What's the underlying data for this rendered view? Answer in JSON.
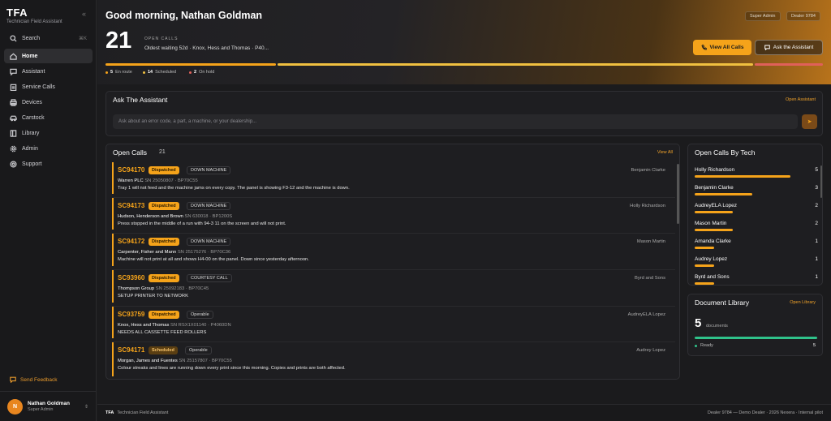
{
  "app": {
    "short": "TFA",
    "name": "Technician Field Assistant"
  },
  "nav": {
    "search": "Search",
    "search_kbd": "⌘K",
    "items": [
      {
        "label": "Home",
        "icon": "home-icon"
      },
      {
        "label": "Assistant",
        "icon": "chat-icon"
      },
      {
        "label": "Service Calls",
        "icon": "clipboard-icon"
      },
      {
        "label": "Devices",
        "icon": "printer-icon"
      },
      {
        "label": "Carstock",
        "icon": "car-icon"
      },
      {
        "label": "Library",
        "icon": "book-icon"
      },
      {
        "label": "Admin",
        "icon": "gear-icon"
      },
      {
        "label": "Support",
        "icon": "lifebuoy-icon"
      }
    ],
    "feedback": "Send Feedback"
  },
  "user": {
    "initial": "N",
    "name": "Nathan Goldman",
    "role": "Super Admin"
  },
  "hero": {
    "greeting": "Good morning, Nathan Goldman",
    "role_pill": "Super Admin",
    "dealer_pill": "Dealer 9784",
    "open_calls": "21",
    "open_calls_label": "OPEN CALLS",
    "oldest": "Oldest waiting 52d · Knox, Hess and Thomas · P40...",
    "view_all": "View All Calls",
    "ask": "Ask the Assistant",
    "stats": [
      {
        "count": "5",
        "label": "En route",
        "color": "#f5a31a"
      },
      {
        "count": "14",
        "label": "Scheduled",
        "color": "#f0c040"
      },
      {
        "count": "2",
        "label": "On hold",
        "color": "#e0605a"
      }
    ]
  },
  "ask_panel": {
    "title": "Ask The Assistant",
    "link": "Open Assistant",
    "placeholder": "Ask about an error code, a part, a machine, or your dealership..."
  },
  "open_calls": {
    "title": "Open Calls",
    "count": "21",
    "link": "View All",
    "rows": [
      {
        "id": "SC94170",
        "status": "Dispatched",
        "type": "DOWN MACHINE",
        "customer": "Warren PLC",
        "sn": "SN 25050807 · BP70C55",
        "desc": "Tray 1 will not feed and the machine jams on every copy. The panel is showing F3-12 and the machine is down.",
        "tech": "Benjamin Clarke"
      },
      {
        "id": "SC94173",
        "status": "Dispatched",
        "type": "DOWN MACHINE",
        "customer": "Hudson, Henderson and Brown",
        "sn": "SN 630018 · BP1200S",
        "desc": "Press stopped in the middle of a run with 94-3 11 on the screen and will not print.",
        "tech": "Holly Richardson"
      },
      {
        "id": "SC94172",
        "status": "Dispatched",
        "type": "DOWN MACHINE",
        "customer": "Carpenter, Fisher and Mann",
        "sn": "SN 25175276 · BP70C36",
        "desc": "Machine will not print at all and shows H4-00 on the panel. Down since yesterday afternoon.",
        "tech": "Mason Martin"
      },
      {
        "id": "SC93960",
        "status": "Dispatched",
        "type": "COURTESY CALL",
        "customer": "Thompson Group",
        "sn": "SN 25092183 · BP70C45",
        "desc": "SETUP PRINTER TO NETWORK",
        "tech": "Byrd and Sons"
      },
      {
        "id": "SC93759",
        "status": "Dispatched",
        "type": "Operable",
        "customer": "Knox, Hess and Thomas",
        "sn": "SN RSX1X01140 · P4060DN",
        "desc": "NEEDS ALL CASSETTE FEED ROLLERS",
        "tech": "AudreyELA Lopez"
      },
      {
        "id": "SC94171",
        "status": "Scheduled",
        "type": "Operable",
        "customer": "Morgan, James and Fuentes",
        "sn": "SN 25157807 · BP70C55",
        "desc": "Colour streaks and lines are running down every print since this morning. Copies and prints are both affected.",
        "tech": "Audrey Lopez"
      }
    ]
  },
  "techs": {
    "title": "Open Calls By Tech",
    "rows": [
      {
        "name": "Holly Richardson",
        "count": 5,
        "fill": 1.0
      },
      {
        "name": "Benjamin Clarke",
        "count": 3,
        "fill": 0.6
      },
      {
        "name": "AudreyELA Lopez",
        "count": 2,
        "fill": 0.4
      },
      {
        "name": "Mason Martin",
        "count": 2,
        "fill": 0.4
      },
      {
        "name": "Amanda Clarke",
        "count": 1,
        "fill": 0.2
      },
      {
        "name": "Audrey Lopez",
        "count": 1,
        "fill": 0.2
      },
      {
        "name": "Byrd and Sons",
        "count": 1,
        "fill": 0.2
      }
    ]
  },
  "library": {
    "title": "Document Library",
    "link": "Open Library",
    "count": "5",
    "label": "documents",
    "ready_label": "Ready",
    "ready_count": "5"
  },
  "footer": {
    "app": "TFA",
    "name": "Technician Field Assistant",
    "right": "Dealer 9784 — Demo Dealer · 2026 Nexera · Internal pilot"
  }
}
